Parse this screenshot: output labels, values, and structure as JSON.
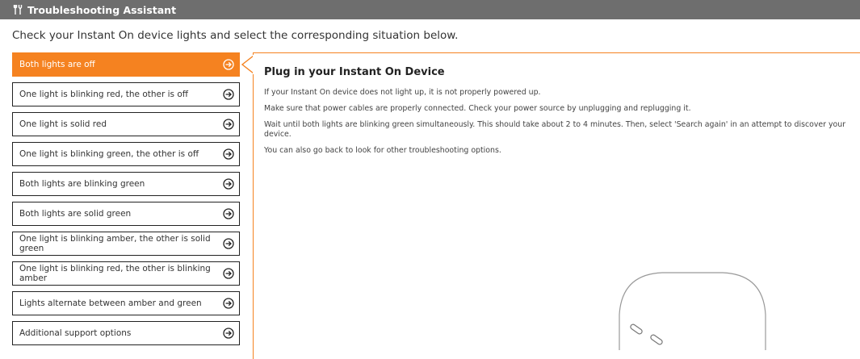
{
  "header": {
    "icon": "tools-icon",
    "title": "Troubleshooting Assistant"
  },
  "instruction": "Check your Instant On device lights and select the corresponding situation below.",
  "options": [
    {
      "label": "Both lights are off",
      "selected": true
    },
    {
      "label": "One light is blinking red, the other is off"
    },
    {
      "label": "One light is solid red"
    },
    {
      "label": "One light is blinking green, the other is off"
    },
    {
      "label": "Both lights are blinking green"
    },
    {
      "label": "Both lights are solid green"
    },
    {
      "label": "One light is blinking amber, the other is solid green"
    },
    {
      "label": "One light is blinking red, the other is blinking amber"
    },
    {
      "label": "Lights alternate between amber and green"
    },
    {
      "label": "Additional support options"
    }
  ],
  "detail": {
    "heading": "Plug in your Instant On Device",
    "paragraphs": [
      "If your Instant On device does not light up, it is not properly powered up.",
      "Make sure that power cables are properly connected. Check your power source by unplugging and replugging it.",
      "Wait until both lights are blinking green simultaneously. This should take about 2 to 4 minutes. Then, select 'Search again' in an attempt to discover your device.",
      "You can also go back to look for other troubleshooting options."
    ]
  },
  "colors": {
    "accent": "#f58220",
    "header_bg": "#6e6e6e",
    "border": "#222222"
  }
}
